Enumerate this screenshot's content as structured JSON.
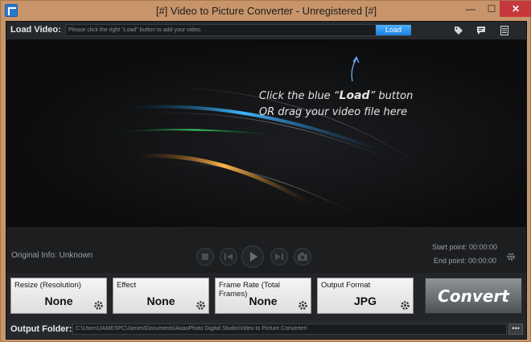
{
  "window": {
    "title": "[#] Video to Picture Converter - Unregistered [#]",
    "controls": {
      "minimize": "—",
      "maximize": "☐",
      "close": "✕"
    }
  },
  "load": {
    "label": "Load Video:",
    "placeholder": "Please click the right \"Load\" button to add your video.",
    "button_label": "Load",
    "icons": [
      "tag-icon",
      "chat-icon",
      "list-icon"
    ]
  },
  "preview": {
    "hint_line1_pre": "Click the blue “",
    "hint_line1_bold": "Load",
    "hint_line1_post": "” button",
    "hint_line2": "OR drag your video file here"
  },
  "playback": {
    "original_info": "Original Info: Unknown",
    "start_point": "Start point: 00:00:00",
    "end_point": "End point: 00:00:00",
    "buttons": [
      "stop-icon",
      "previous-icon",
      "play-icon",
      "next-icon",
      "snapshot-icon"
    ]
  },
  "settings": {
    "resize": {
      "label": "Resize (Resolution)",
      "value": "None"
    },
    "effect": {
      "label": "Effect",
      "value": "None"
    },
    "frame_rate": {
      "label": "Frame Rate (Total Frames)",
      "value": "None"
    },
    "output_format": {
      "label": "Output Format",
      "value": "JPG"
    },
    "convert_label": "Convert"
  },
  "output": {
    "label": "Output Folder:",
    "path": "C:\\Users\\JAMESPC\\James\\Documents\\AoaoPhoto Digital Studio\\Video to Picture Converter\\",
    "browse_label": "•••"
  },
  "colors": {
    "accent_blue": "#1b7fdc",
    "window_frame": "#c8956a",
    "close_red": "#c7383c",
    "panel_dark": "#222426"
  }
}
